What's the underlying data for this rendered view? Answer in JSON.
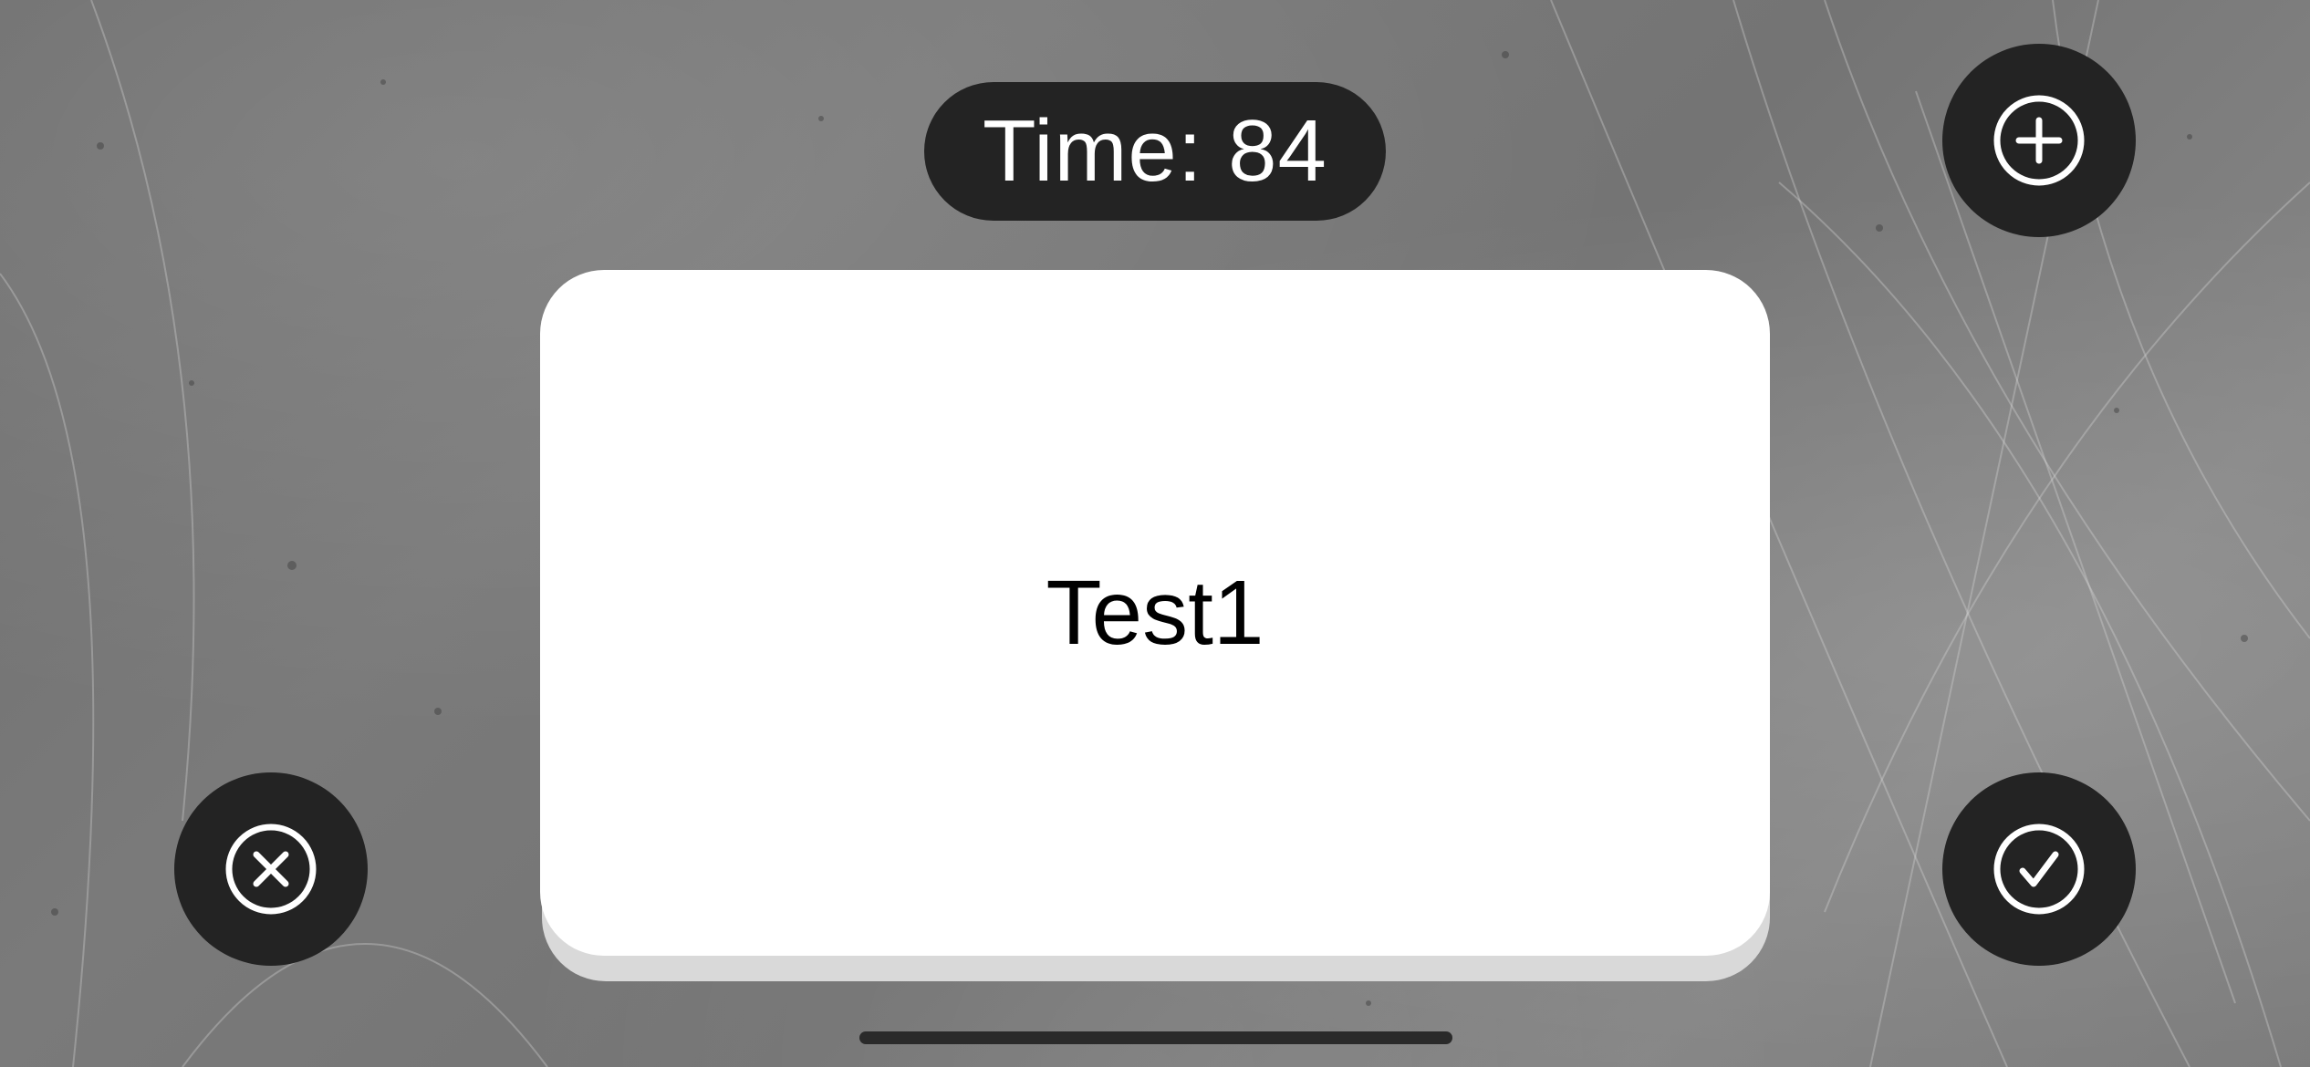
{
  "timer": {
    "text": "Time: 84"
  },
  "card": {
    "word": "Test1"
  },
  "buttons": {
    "add": {
      "icon": "plus-circle-icon"
    },
    "wrong": {
      "icon": "x-circle-icon"
    },
    "correct": {
      "icon": "checkmark-circle-icon"
    }
  },
  "colors": {
    "pill_background": "#232323",
    "card_background": "#ffffff",
    "icon_stroke": "#ffffff"
  }
}
